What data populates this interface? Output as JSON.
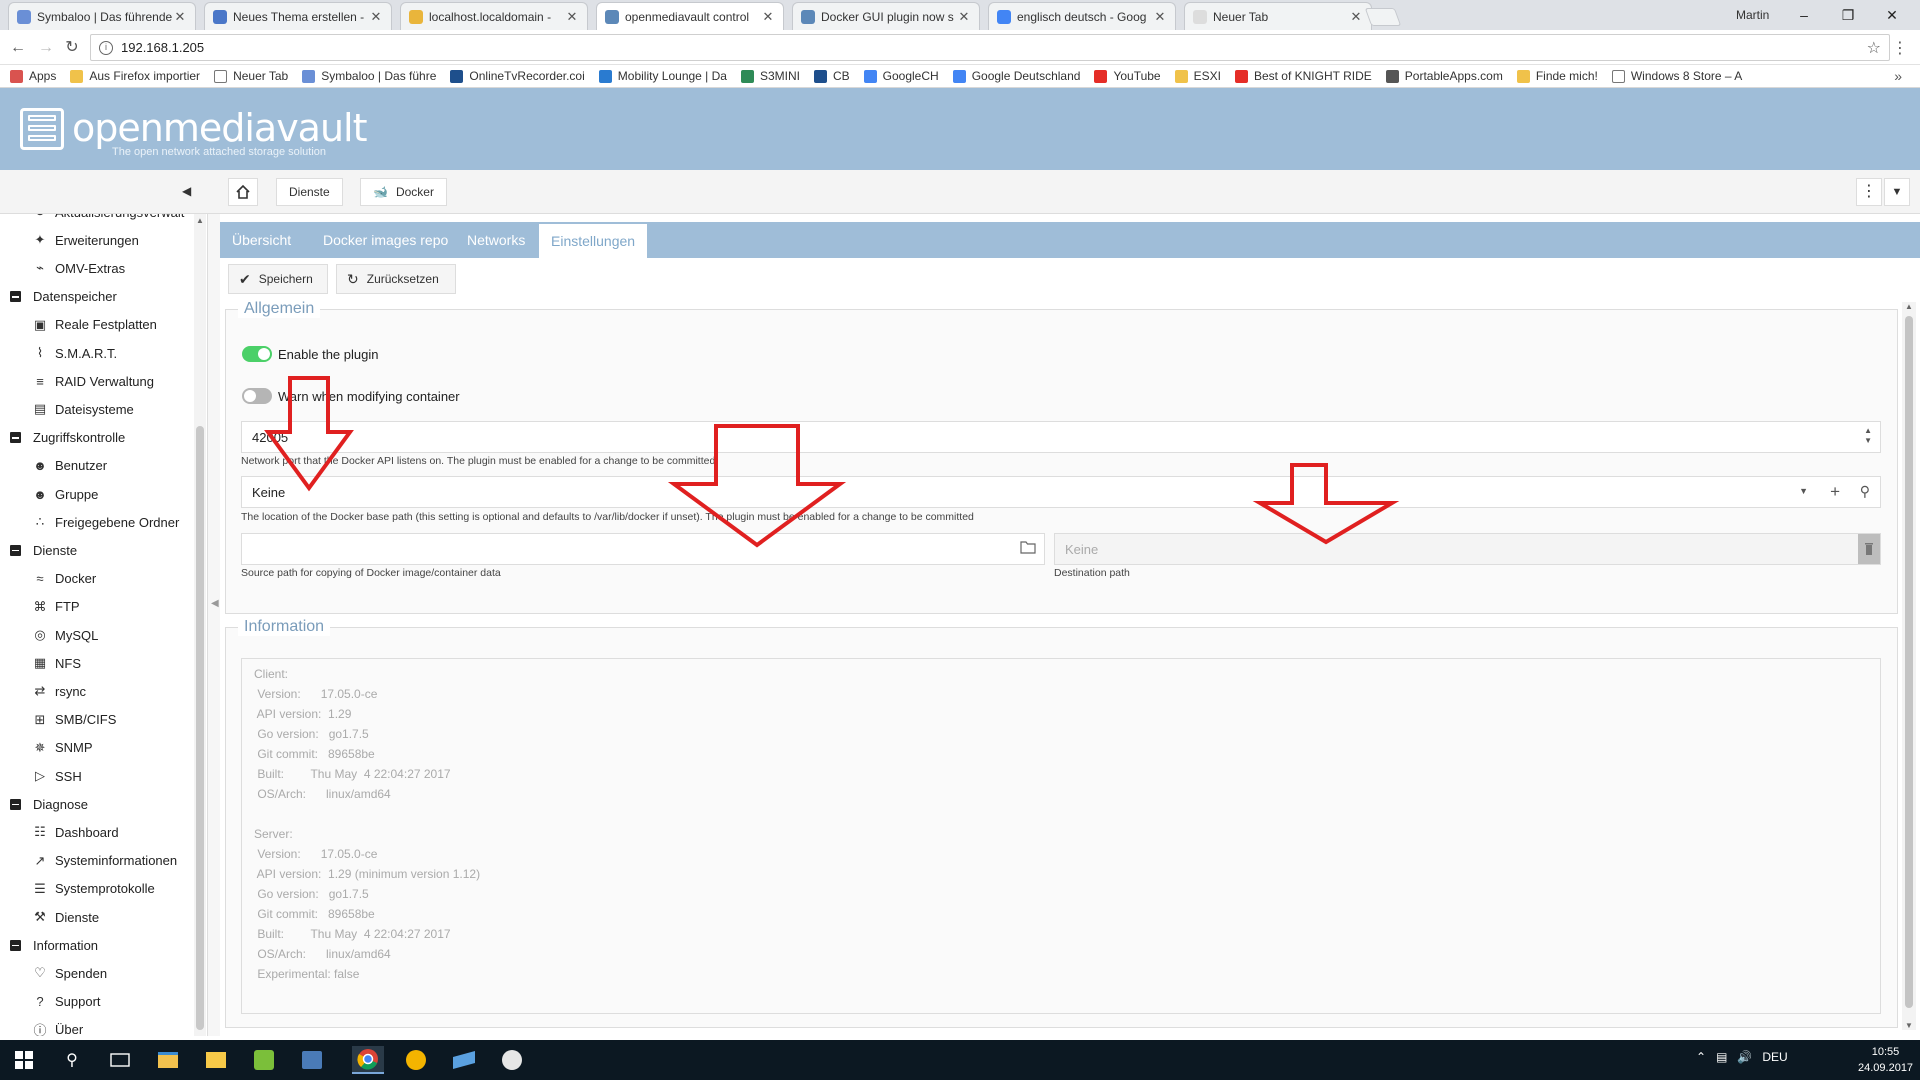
{
  "browser": {
    "tabs": [
      {
        "title": "Symbaloo | Das führende",
        "color": "#6a8fd6"
      },
      {
        "title": "Neues Thema erstellen -",
        "color": "#4a77c8"
      },
      {
        "title": "localhost.localdomain -",
        "color": "#e9b53b"
      },
      {
        "title": "openmediavault control",
        "color": "#5c88b8"
      },
      {
        "title": "Docker GUI plugin now s",
        "color": "#5c88b8"
      },
      {
        "title": "englisch deutsch - Goog",
        "color": "#4285f4"
      },
      {
        "title": "Neuer Tab",
        "color": "#dddddd"
      }
    ],
    "active_tab_index": 3,
    "profile": "Martin",
    "url": "192.168.1.205",
    "bookmarks": [
      {
        "label": "Apps",
        "color": "#d9534f"
      },
      {
        "label": "Aus Firefox importier",
        "color": "#f0c24a"
      },
      {
        "label": "Neuer Tab",
        "color": "#ffffff"
      },
      {
        "label": "Symbaloo | Das führe",
        "color": "#6a8fd6"
      },
      {
        "label": "OnlineTvRecorder.coi",
        "color": "#1e4f8c"
      },
      {
        "label": "Mobility Lounge | Da",
        "color": "#2a7bd0"
      },
      {
        "label": "S3MINI",
        "color": "#2e8b57"
      },
      {
        "label": "CB",
        "color": "#1e4f8c"
      },
      {
        "label": "GoogleCH",
        "color": "#4285f4"
      },
      {
        "label": "Google Deutschland",
        "color": "#4285f4"
      },
      {
        "label": "YouTube",
        "color": "#e52d27"
      },
      {
        "label": "ESXI",
        "color": "#f0c24a"
      },
      {
        "label": "Best of KNIGHT RIDE",
        "color": "#e52d27"
      },
      {
        "label": "PortableApps.com",
        "color": "#555555"
      },
      {
        "label": "Finde mich!",
        "color": "#f0c24a"
      },
      {
        "label": "Windows 8 Store – A",
        "color": "#ffffff"
      }
    ]
  },
  "omv": {
    "title": "openmediavault",
    "subtitle": "The open network attached storage solution",
    "breadcrumb": [
      "Dienste",
      "Docker"
    ]
  },
  "sidebar": {
    "rows": [
      {
        "type": "item",
        "label": "Aktualisierungsverwalt",
        "icon": "update-icon"
      },
      {
        "type": "item",
        "label": "Erweiterungen",
        "icon": "puzzle-icon"
      },
      {
        "type": "item",
        "label": "OMV-Extras",
        "icon": "plug-icon"
      },
      {
        "type": "group",
        "label": "Datenspeicher"
      },
      {
        "type": "item",
        "label": "Reale Festplatten",
        "icon": "disk-icon"
      },
      {
        "type": "item",
        "label": "S.M.A.R.T.",
        "icon": "pulse-icon"
      },
      {
        "type": "item",
        "label": "RAID Verwaltung",
        "icon": "database-icon"
      },
      {
        "type": "item",
        "label": "Dateisysteme",
        "icon": "filesystem-icon"
      },
      {
        "type": "group",
        "label": "Zugriffskontrolle"
      },
      {
        "type": "item",
        "label": "Benutzer",
        "icon": "user-icon"
      },
      {
        "type": "item",
        "label": "Gruppe",
        "icon": "group-icon"
      },
      {
        "type": "item",
        "label": "Freigegebene Ordner",
        "icon": "share-icon"
      },
      {
        "type": "group",
        "label": "Dienste"
      },
      {
        "type": "item",
        "label": "Docker",
        "icon": "docker-icon"
      },
      {
        "type": "item",
        "label": "FTP",
        "icon": "ftp-icon"
      },
      {
        "type": "item",
        "label": "MySQL",
        "icon": "mysql-icon"
      },
      {
        "type": "item",
        "label": "NFS",
        "icon": "nfs-icon"
      },
      {
        "type": "item",
        "label": "rsync",
        "icon": "rsync-icon"
      },
      {
        "type": "item",
        "label": "SMB/CIFS",
        "icon": "windows-icon"
      },
      {
        "type": "item",
        "label": "SNMP",
        "icon": "network-icon"
      },
      {
        "type": "item",
        "label": "SSH",
        "icon": "terminal-icon"
      },
      {
        "type": "group",
        "label": "Diagnose"
      },
      {
        "type": "item",
        "label": "Dashboard",
        "icon": "dashboard-icon"
      },
      {
        "type": "item",
        "label": "Systeminformationen",
        "icon": "chart-icon"
      },
      {
        "type": "item",
        "label": "Systemprotokolle",
        "icon": "log-icon"
      },
      {
        "type": "item",
        "label": "Dienste",
        "icon": "wrench-icon"
      },
      {
        "type": "group",
        "label": "Information"
      },
      {
        "type": "item",
        "label": "Spenden",
        "icon": "heart-icon"
      },
      {
        "type": "item",
        "label": "Support",
        "icon": "question-icon"
      },
      {
        "type": "item",
        "label": "Über",
        "icon": "info-icon"
      }
    ]
  },
  "main": {
    "tabs": [
      "Übersicht",
      "Docker images repo",
      "Networks",
      "Einstellungen"
    ],
    "active_tab": 3,
    "save_label": "Speichern",
    "reset_label": "Zurücksetzen",
    "general": {
      "legend": "Allgemein",
      "enable_label": "Enable the plugin",
      "enable_on": true,
      "warn_label": "Warn when modifying container",
      "warn_on": false,
      "port_value": "42005",
      "port_hint": "Network port that the Docker API listens on. The plugin must be enabled for a change to be committed",
      "base_path_value": "Keine",
      "base_path_hint": "The location of the Docker base path (this setting is optional and defaults to /var/lib/docker if unset). The plugin must be enabled for a change to be committed",
      "source_value": "",
      "source_hint": "Source path for copying of Docker image/container data",
      "dest_placeholder": "Keine",
      "dest_hint": "Destination path"
    },
    "information": {
      "legend": "Information",
      "lines": [
        "Client:",
        " Version:      17.05.0-ce",
        " API version:  1.29",
        " Go version:   go1.7.5",
        " Git commit:   89658be",
        " Built:        Thu May  4 22:04:27 2017",
        " OS/Arch:      linux/amd64",
        "",
        "Server:",
        " Version:      17.05.0-ce",
        " API version:  1.29 (minimum version 1.12)",
        " Go version:   go1.7.5",
        " Git commit:   89658be",
        " Built:        Thu May  4 22:04:27 2017",
        " OS/Arch:      linux/amd64",
        " Experimental: false"
      ]
    }
  },
  "taskbar": {
    "language": "DEU",
    "time": "10:55",
    "date": "24.09.2017"
  },
  "colors": {
    "header_blue": "#9fbdd8",
    "toggle_on": "#4bd068",
    "annotation_arrow": "#e02020"
  }
}
